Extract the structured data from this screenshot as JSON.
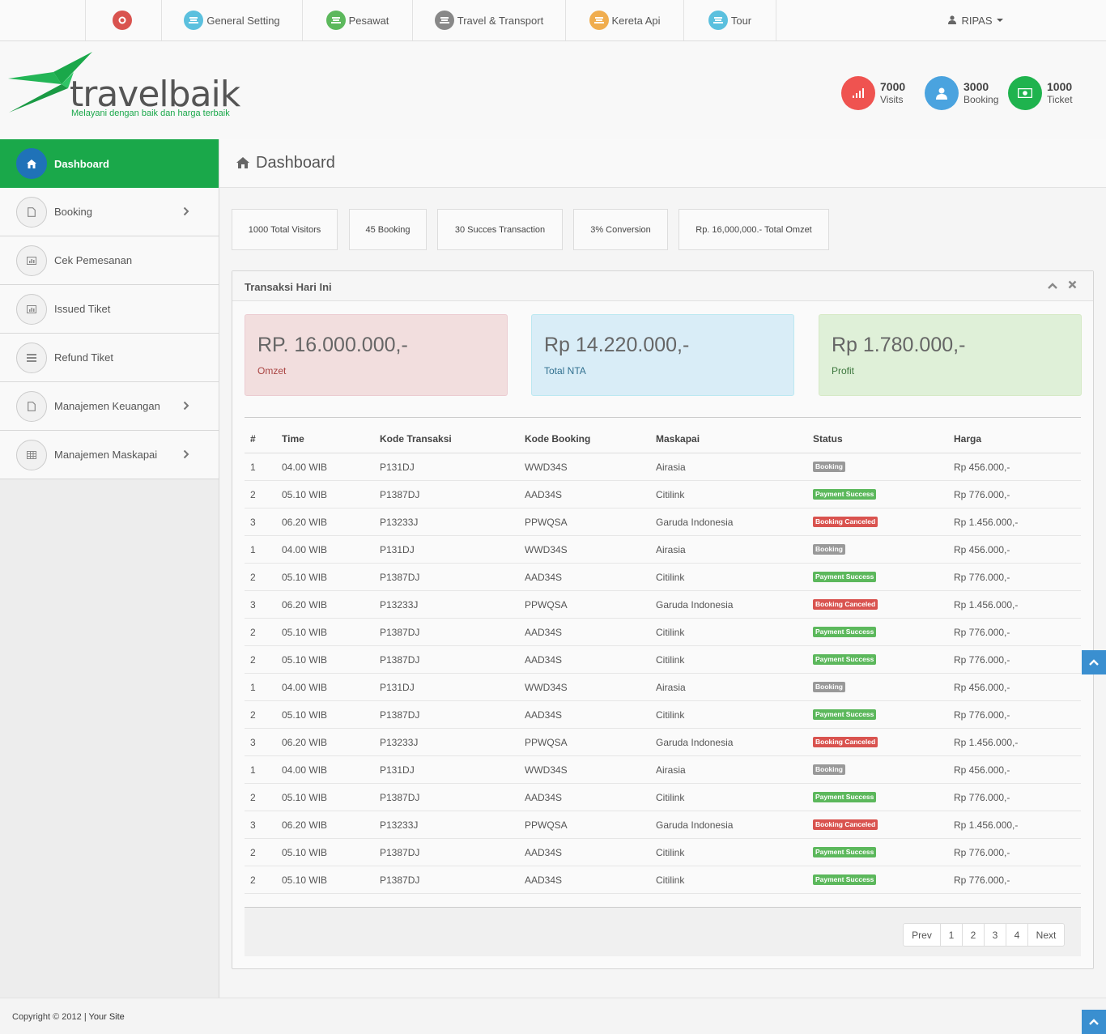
{
  "topnav": {
    "items": [
      {
        "label": "",
        "icon": "gears-icon",
        "color": "#d9534f"
      },
      {
        "label": "General Setting",
        "icon": "ticket-icon",
        "color": "#5bc0de"
      },
      {
        "label": "Pesawat",
        "icon": "ticket-icon",
        "color": "#5cb85c"
      },
      {
        "label": "Travel & Transport",
        "icon": "ticket-icon",
        "color": "#888888"
      },
      {
        "label": "Kereta Api",
        "icon": "ticket-icon",
        "color": "#f0ad4e"
      },
      {
        "label": "Tour",
        "icon": "ticket-icon",
        "color": "#5bc0de"
      }
    ],
    "user": "RIPAS"
  },
  "brand": {
    "name": "travelbaik",
    "tagline": "Melayani dengan baik dan harga terbaik"
  },
  "stats": [
    {
      "num": "7000",
      "label": "Visits",
      "color": "#ef5350",
      "icon": "signal-icon"
    },
    {
      "num": "3000",
      "label": "Booking",
      "color": "#4aa3df",
      "icon": "user-icon"
    },
    {
      "num": "1000",
      "label": "Ticket",
      "color": "#1fb34e",
      "icon": "money-icon"
    }
  ],
  "sidebar": {
    "items": [
      {
        "label": "Dashboard",
        "icon": "home-icon",
        "chevron": false
      },
      {
        "label": "Booking",
        "icon": "file-icon",
        "chevron": true
      },
      {
        "label": "Cek Pemesanan",
        "icon": "chart-icon",
        "chevron": false
      },
      {
        "label": "Issued Tiket",
        "icon": "chart-icon",
        "chevron": false
      },
      {
        "label": "Refund Tiket",
        "icon": "list-icon",
        "chevron": false
      },
      {
        "label": "Manajemen Keuangan",
        "icon": "file-icon",
        "chevron": true
      },
      {
        "label": "Manajemen Maskapai",
        "icon": "table-icon",
        "chevron": true
      }
    ]
  },
  "page": {
    "title": "Dashboard"
  },
  "summary_pills": [
    "1000 Total Visitors",
    "45 Booking",
    "30 Succes Transaction",
    "3% Conversion",
    "Rp. 16,000,000.- Total Omzet"
  ],
  "panel": {
    "title": "Transaksi Hari Ini",
    "boxes": [
      {
        "amount": "RP. 16.000.000,-",
        "caption": "Omzet",
        "bg": "#f2dede",
        "border": "#ebccd1",
        "capColor": "#a94442"
      },
      {
        "amount": "Rp 14.220.000,-",
        "caption": "Total NTA",
        "bg": "#d9edf7",
        "border": "#bce8f1",
        "capColor": "#31708f"
      },
      {
        "amount": "Rp 1.780.000,-",
        "caption": "Profit",
        "bg": "#dff0d8",
        "border": "#d6e9c6",
        "capColor": "#3c763d"
      }
    ],
    "table": {
      "headers": [
        "#",
        "Time",
        "Kode Transaksi",
        "Kode Booking",
        "Maskapai",
        "Status",
        "Harga"
      ],
      "rows": [
        [
          "1",
          "04.00 WIB",
          "P131DJ",
          "WWD34S",
          "Airasia",
          "Booking",
          "Rp 456.000,-"
        ],
        [
          "2",
          "05.10 WIB",
          "P1387DJ",
          "AAD34S",
          "Citilink",
          "Payment Success",
          "Rp 776.000,-"
        ],
        [
          "3",
          "06.20 WIB",
          "P13233J",
          "PPWQSA",
          "Garuda Indonesia",
          "Booking Canceled",
          "Rp 1.456.000,-"
        ],
        [
          "1",
          "04.00 WIB",
          "P131DJ",
          "WWD34S",
          "Airasia",
          "Booking",
          "Rp 456.000,-"
        ],
        [
          "2",
          "05.10 WIB",
          "P1387DJ",
          "AAD34S",
          "Citilink",
          "Payment Success",
          "Rp 776.000,-"
        ],
        [
          "3",
          "06.20 WIB",
          "P13233J",
          "PPWQSA",
          "Garuda Indonesia",
          "Booking Canceled",
          "Rp 1.456.000,-"
        ],
        [
          "2",
          "05.10 WIB",
          "P1387DJ",
          "AAD34S",
          "Citilink",
          "Payment Success",
          "Rp 776.000,-"
        ],
        [
          "2",
          "05.10 WIB",
          "P1387DJ",
          "AAD34S",
          "Citilink",
          "Payment Success",
          "Rp 776.000,-"
        ],
        [
          "1",
          "04.00 WIB",
          "P131DJ",
          "WWD34S",
          "Airasia",
          "Booking",
          "Rp 456.000,-"
        ],
        [
          "2",
          "05.10 WIB",
          "P1387DJ",
          "AAD34S",
          "Citilink",
          "Payment Success",
          "Rp 776.000,-"
        ],
        [
          "3",
          "06.20 WIB",
          "P13233J",
          "PPWQSA",
          "Garuda Indonesia",
          "Booking Canceled",
          "Rp 1.456.000,-"
        ],
        [
          "1",
          "04.00 WIB",
          "P131DJ",
          "WWD34S",
          "Airasia",
          "Booking",
          "Rp 456.000,-"
        ],
        [
          "2",
          "05.10 WIB",
          "P1387DJ",
          "AAD34S",
          "Citilink",
          "Payment Success",
          "Rp 776.000,-"
        ],
        [
          "3",
          "06.20 WIB",
          "P13233J",
          "PPWQSA",
          "Garuda Indonesia",
          "Booking Canceled",
          "Rp 1.456.000,-"
        ],
        [
          "2",
          "05.10 WIB",
          "P1387DJ",
          "AAD34S",
          "Citilink",
          "Payment Success",
          "Rp 776.000,-"
        ],
        [
          "2",
          "05.10 WIB",
          "P1387DJ",
          "AAD34S",
          "Citilink",
          "Payment Success",
          "Rp 776.000,-"
        ]
      ],
      "status_colors": {
        "Booking": "#999999",
        "Payment Success": "#5cb85c",
        "Booking Canceled": "#d9534f"
      }
    },
    "pagination": [
      "Prev",
      "1",
      "2",
      "3",
      "4",
      "Next"
    ]
  },
  "footer": {
    "copyright": "Copyright © 2012 | ",
    "site": "Your Site"
  }
}
